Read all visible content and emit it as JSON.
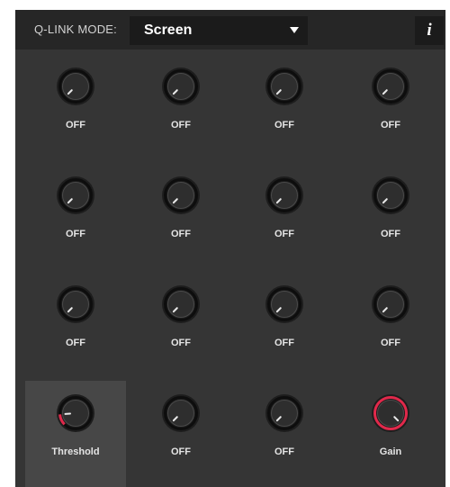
{
  "header": {
    "mode_label": "Q-LINK MODE:",
    "mode_value": "Screen",
    "info_icon": "i"
  },
  "colors": {
    "accent": "#e0294b",
    "panel": "#353535",
    "header": "#262626"
  },
  "knobs": [
    {
      "label": "OFF",
      "level": 0,
      "active": false
    },
    {
      "label": "OFF",
      "level": 0,
      "active": false
    },
    {
      "label": "OFF",
      "level": 0,
      "active": false
    },
    {
      "label": "OFF",
      "level": 0,
      "active": false
    },
    {
      "label": "OFF",
      "level": 0,
      "active": false
    },
    {
      "label": "OFF",
      "level": 0,
      "active": false
    },
    {
      "label": "OFF",
      "level": 0,
      "active": false
    },
    {
      "label": "OFF",
      "level": 0,
      "active": false
    },
    {
      "label": "OFF",
      "level": 0,
      "active": false
    },
    {
      "label": "OFF",
      "level": 0,
      "active": false
    },
    {
      "label": "OFF",
      "level": 0,
      "active": false
    },
    {
      "label": "OFF",
      "level": 0,
      "active": false
    },
    {
      "label": "Threshold",
      "level": 0.15,
      "active": true,
      "selected": true
    },
    {
      "label": "OFF",
      "level": 0,
      "active": false
    },
    {
      "label": "OFF",
      "level": 0,
      "active": false
    },
    {
      "label": "Gain",
      "level": 1.0,
      "active": true
    }
  ]
}
